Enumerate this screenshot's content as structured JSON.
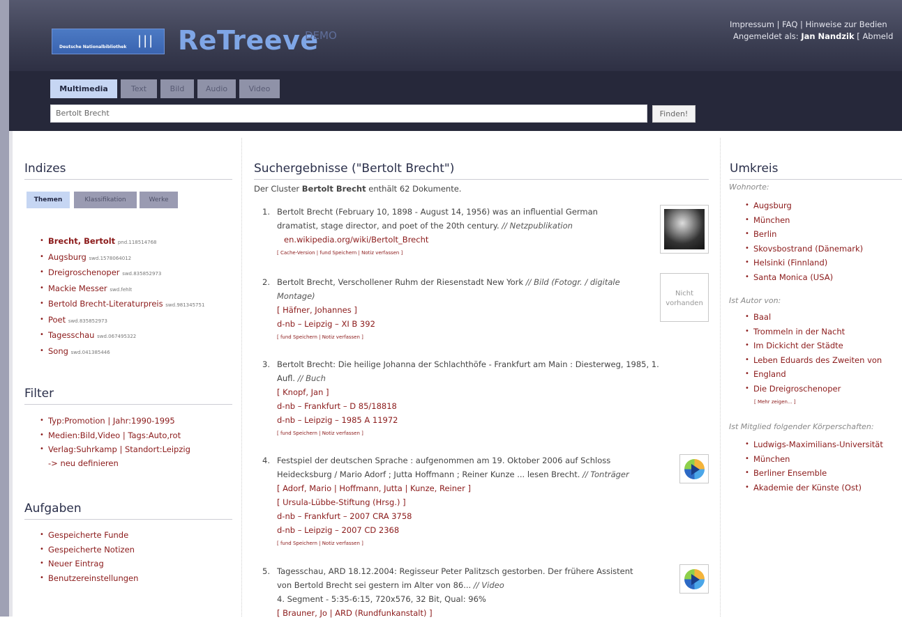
{
  "header": {
    "logo_text": "Deutsche Nationalbibliothek",
    "brand": "ReTreeve",
    "brand_suffix": "DEMO",
    "links": "Impressum | FAQ | Hinweise zur Bedien",
    "logged_in_prefix": "Angemeldet als: ",
    "user": "Jan Nandzik",
    "logout": " [ Abmeld"
  },
  "search": {
    "tabs": [
      "Multimedia",
      "Text",
      "Bild",
      "Audio",
      "Video"
    ],
    "query": "Bertolt Brecht",
    "button": "Finden!"
  },
  "left": {
    "indizes_title": "Indizes",
    "subtabs": [
      "Themen",
      "Klassifikation",
      "Werke"
    ],
    "index_items": [
      {
        "label": "Brecht, Bertolt",
        "meta": "pnd.118514768"
      },
      {
        "label": "Augsburg",
        "meta": "swd.1578064012"
      },
      {
        "label": "Dreigroschenoper",
        "meta": "swd.835852973"
      },
      {
        "label": "Mackie Messer",
        "meta": "swd.fehlt"
      },
      {
        "label": "Bertold Brecht-Literaturpreis",
        "meta": "swd.981345751"
      },
      {
        "label": "Poet",
        "meta": "swd.835852973"
      },
      {
        "label": "Tagesschau",
        "meta": "swd.067495322"
      },
      {
        "label": "Song",
        "meta": "swd.041385446"
      }
    ],
    "filter_title": "Filter",
    "filters": [
      "Typ:Promotion | Jahr:1990-1995",
      "Medien:Bild,Video | Tags:Auto,rot",
      "Verlag:Suhrkamp | Standort:Leipzig"
    ],
    "filter_define": "-> neu definieren",
    "tasks_title": "Aufgaben",
    "tasks": [
      "Gespeicherte Funde",
      "Gespeicherte Notizen",
      "Neuer Eintrag",
      "Benutzereinstellungen"
    ]
  },
  "results": {
    "title": "Suchergebnisse (\"Bertolt Brecht\")",
    "summary_pre": "Der Cluster ",
    "summary_bold": "Bertolt Brecht",
    "summary_post": " enthält 62 Dokumente.",
    "items": [
      {
        "num": "1.",
        "line1": "Bertolt Brecht (February 10, 1898 - August 14, 1956) was an influential German",
        "line2": "dramatist, stage director, and poet of the 20th century. ",
        "type": "// Netzpublikation",
        "link": "en.wikipedia.org/wiki/Bertolt_Brecht",
        "actions": "[ Cache-Version | fund Speichern | Notiz verfassen ]"
      },
      {
        "num": "2.",
        "line1": "Bertolt Brecht, Verschollener Ruhm der Riesenstadt New York ",
        "type": "// Bild (Fotogr. / digitale",
        "type2": "Montage)",
        "author": "[ Häfner, Johannes ]",
        "loc1": "d-nb – Leipzig – XI B 392",
        "actions": "[ fund Speichern | Notiz verfassen ]",
        "thumb": "Nicht vorhanden"
      },
      {
        "num": "3.",
        "line1": "Bertolt Brecht: Die heilige Johanna der Schlachthöfe - Frankfurt am Main : Diesterweg, 1985, 1.",
        "line2": "Aufl. ",
        "type": "// Buch",
        "author": "[ Knopf, Jan ]",
        "loc1": "d-nb – Frankfurt – D 85/18818",
        "loc2": "d-nb – Leipzig – 1985 A 11972",
        "actions": "[ fund Speichern | Notiz verfassen ]"
      },
      {
        "num": "4.",
        "line1": "Festspiel der deutschen Sprache : aufgenommen am 19. Oktober 2006 auf Schloss",
        "line2": "Heidecksburg / Mario Adorf ; Jutta Hoffmann ; Reiner Kunze ... lesen Brecht. ",
        "type": "// Tonträger",
        "author": "[ Adorf, Mario | Hoffmann, Jutta | Kunze, Reiner ]",
        "author2": "[ Ursula-Lübbe-Stiftung (Hrsg.) ]",
        "loc1": "d-nb – Frankfurt – 2007 CRA 3758",
        "loc2": "d-nb – Leipzig – 2007 CD 2368",
        "actions": "[ fund Speichern | Notiz verfassen ]"
      },
      {
        "num": "5.",
        "line1": "Tagesschau, ARD 18.12.2004: Regisseur Peter Palitzsch gestorben. Der frühere Assistent",
        "line2": "von Bertold Brecht sei gestern im Alter von 86... ",
        "type": "// Video",
        "line3": "4. Segment - 5:35-6:15, 720x576, 32 Bit, Qual: 96%",
        "author": "[ Brauner, Jo | ARD (Rundfunkanstalt) ]"
      }
    ]
  },
  "right": {
    "title": "Umkreis",
    "wohnorte_label": "Wohnorte:",
    "wohnorte": [
      "Augsburg",
      "München",
      "Berlin",
      "Skovsbostrand (Dänemark)",
      "Helsinki (Finnland)",
      "Santa Monica (USA)"
    ],
    "autor_label": "Ist Autor von:",
    "werke": [
      "Baal",
      "Trommeln in der Nacht",
      "Im Dickicht der Städte",
      "Leben Eduards des Zweiten von",
      "Die Dreigroschenoper"
    ],
    "werke_cont": "England",
    "more": "[ Mehr zeigen... ]",
    "mitglied_label": "Ist Mitglied folgender Körperschaften:",
    "mitglied": [
      "Ludwigs-Maximilians-Universität",
      "Berliner Ensemble",
      "Akademie der Künste (Ost)"
    ],
    "mitglied_cont": "München"
  }
}
